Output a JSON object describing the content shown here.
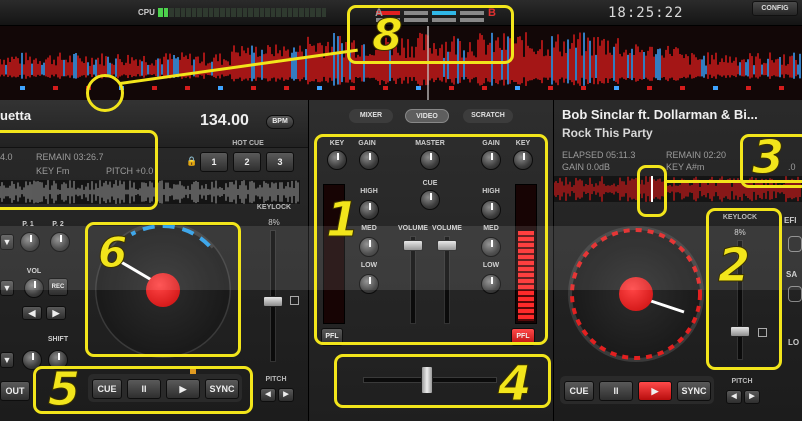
{
  "topbar": {
    "cpu_label": "CPU",
    "clock": "18:25:22",
    "config_label": "CONFIG",
    "mini_a": "A",
    "mini_b": "B"
  },
  "mixer": {
    "tabs": [
      "MIXER",
      "VIDEO",
      "SCRATCH"
    ],
    "active_tab": "VIDEO",
    "left": {
      "key": "KEY",
      "gain": "GAIN",
      "high": "HIGH",
      "med": "MED",
      "low": "LOW",
      "volume": "VOLUME"
    },
    "right": {
      "key": "KEY",
      "gain": "GAIN",
      "high": "HIGH",
      "med": "MED",
      "low": "LOW",
      "volume": "VOLUME"
    },
    "master": "MASTER",
    "cue": "CUE",
    "pfl_left": "PFL",
    "pfl_right": "PFL"
  },
  "deck_left": {
    "title": "uetta",
    "bpm_value": "134.00",
    "bpm_label": "BPM",
    "time_partial": "4.0",
    "remain": "REMAIN 03:26.7",
    "key": "KEY Fm",
    "pitch": "PITCH +0.0",
    "hot_cue_label": "HOT CUE",
    "hot_cues": [
      "1",
      "2",
      "3"
    ],
    "keylock_label": "KEYLOCK",
    "pitch_pct": "8%",
    "p1": "P. 1",
    "p2": "P. 2",
    "vol": "VOL",
    "rec": "REC",
    "shift": "SHIFT",
    "out": "OUT",
    "pitch_label": "PITCH",
    "transport": {
      "cue": "CUE",
      "pause": "II",
      "play": "▶",
      "sync": "SYNC"
    }
  },
  "deck_right": {
    "title": "Bob Sinclar ft. Dollarman & Bi...",
    "subtitle": "Rock This Party",
    "elapsed": "ELAPSED 05:11.3",
    "remain": "REMAIN 02:20",
    "gain": "GAIN 0.0dB",
    "key": "KEY A#m",
    "pitch_partial": ".0",
    "keylock_label": "KEYLOCK",
    "pitch_pct": "8%",
    "side_labels": [
      "EFI",
      "SA",
      "LO"
    ],
    "pitch_label": "PITCH",
    "transport": {
      "cue": "CUE",
      "pause": "II",
      "play": "▶",
      "sync": "SYNC"
    }
  },
  "annotations": {
    "numbers": [
      "1",
      "2",
      "3",
      "4",
      "5",
      "6",
      "8"
    ]
  },
  "colors": {
    "accent_red": "#e01818",
    "annotation_yellow": "#f2e51b",
    "wave_blue": "#3ea3ff"
  },
  "icons": {
    "lock": "lock-icon",
    "play": "play-icon",
    "chevron_left": "chevron-left-icon",
    "chevron_right": "chevron-right-icon"
  }
}
